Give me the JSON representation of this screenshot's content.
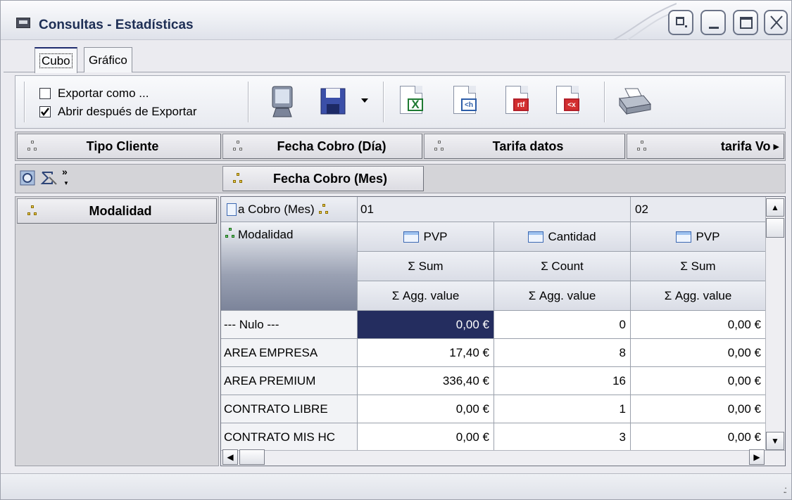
{
  "window": {
    "title": "Consultas - Estadísticas"
  },
  "tabs": [
    {
      "label": "Cubo",
      "active": true
    },
    {
      "label": "Gráfico",
      "active": false
    }
  ],
  "toolbar": {
    "export_as_label": "Exportar como ...",
    "export_as_checked": false,
    "open_after_export_label": "Abrir después de Exportar",
    "open_after_export_checked": true,
    "buttons": [
      "monitor-icon",
      "save-icon",
      "dropdown-arrow-icon",
      "excel-export-icon",
      "html-export-icon",
      "rtf-export-icon",
      "xml-export-icon",
      "printer-icon"
    ],
    "badges": {
      "excel": "X",
      "html": "<h",
      "rtf": "rtf",
      "xml": "<x"
    }
  },
  "fields_bar": {
    "items": [
      "Tipo Cliente",
      "Fecha Cobro (Día)",
      "Tarifa datos",
      "tarifa Vo"
    ]
  },
  "column_field": {
    "label": "Fecha Cobro (Mes)"
  },
  "row_field": {
    "label": "Modalidad"
  },
  "grid": {
    "column_header_field": "a Cobro (Mes)",
    "row_header_field": "Modalidad",
    "column_groups": [
      "01",
      "02"
    ],
    "measures": [
      {
        "name": "PVP",
        "agg": "Σ  Sum",
        "value": "Σ  Agg. value"
      },
      {
        "name": "Cantidad",
        "agg": "Σ  Count",
        "value": "Σ  Agg. value"
      },
      {
        "name": "PVP",
        "agg": "Σ  Sum",
        "value": "Σ  Agg. value"
      }
    ],
    "rows": [
      {
        "label": "--- Nulo ---",
        "values": [
          "0,00 €",
          "0",
          "0,00 €"
        ]
      },
      {
        "label": "AREA EMPRESA",
        "values": [
          "17,40 €",
          "8",
          "0,00 €"
        ]
      },
      {
        "label": "AREA PREMIUM",
        "values": [
          "336,40 €",
          "16",
          "0,00 €"
        ]
      },
      {
        "label": "CONTRATO LIBRE",
        "values": [
          "0,00 €",
          "1",
          "0,00 €"
        ]
      },
      {
        "label": "CONTRATO MIS HC",
        "values": [
          "0,00 €",
          "3",
          "0,00 €"
        ]
      }
    ]
  },
  "colors": {
    "selected_cell": "#242d5f",
    "title_text": "#1d2e55"
  }
}
